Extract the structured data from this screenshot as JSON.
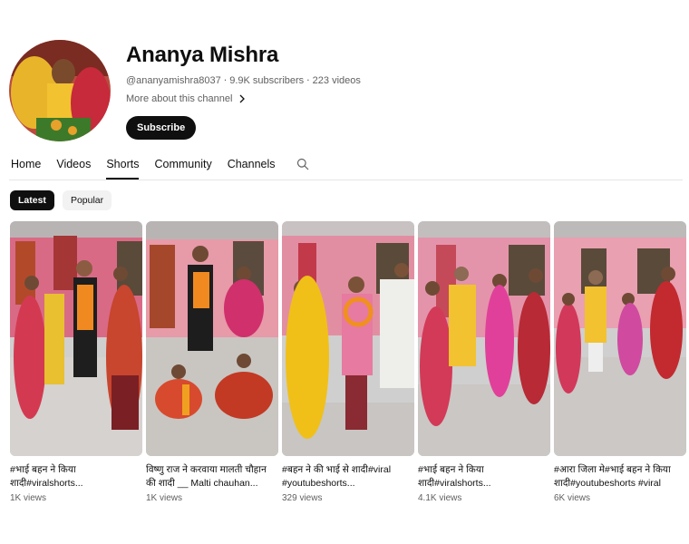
{
  "channel": {
    "name": "Ananya Mishra",
    "handle": "@ananyamishra8037",
    "subscribers": "9.9K subscribers",
    "videos": "223 videos",
    "about": "More about this channel",
    "subscribe_label": "Subscribe",
    "separator": "‧"
  },
  "tabs": [
    {
      "label": "Home"
    },
    {
      "label": "Videos"
    },
    {
      "label": "Shorts"
    },
    {
      "label": "Community"
    },
    {
      "label": "Channels"
    }
  ],
  "active_tab": "Shorts",
  "chips": [
    {
      "label": "Latest"
    },
    {
      "label": "Popular"
    }
  ],
  "shorts": [
    {
      "title": "#भाई बहन ने किया शादी#viralshorts...",
      "views": "1K views"
    },
    {
      "title": "विष्णु राज ने करवाया मालती चौहान की शादी __ Malti chauhan...",
      "views": "1K views"
    },
    {
      "title": "#बहन ने की भाई से शादी#viral #youtubeshorts...",
      "views": "329 views"
    },
    {
      "title": "#भाई बहन ने किया शादी#viralshorts...",
      "views": "4.1K views"
    },
    {
      "title": "#आरा जिला मे#भाई बहन ने किया शादी#youtubeshorts #viral",
      "views": "6K views"
    }
  ],
  "colors": {
    "text": "#0f0f0f",
    "secondary_text": "#606060",
    "chip_bg": "#f2f2f2",
    "active_chip_bg": "#0f0f0f"
  },
  "icons": {
    "about_chevron": "chevron-right-icon",
    "tab_search": "search-icon"
  }
}
